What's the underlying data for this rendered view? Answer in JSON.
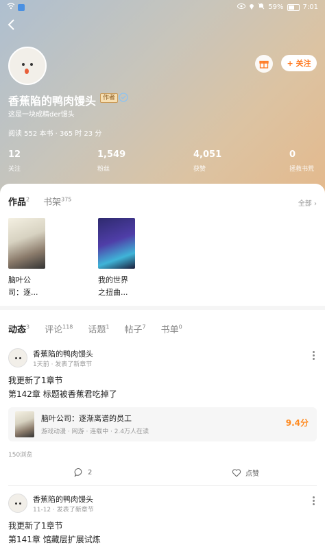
{
  "status_bar": {
    "battery": "59%",
    "time": "7:01"
  },
  "profile": {
    "username": "香蕉陷的鸭肉馒头",
    "badge": "作者",
    "bio": "这是一块成精der馒头",
    "read_stats": "阅读 552 本书 · 365 时 23 分",
    "follow_label": "+ 关注"
  },
  "stats": [
    {
      "value": "12",
      "label": "关注"
    },
    {
      "value": "1,549",
      "label": "粉丝"
    },
    {
      "value": "4,051",
      "label": "获赞"
    },
    {
      "value": "0",
      "label": "拯救书荒"
    }
  ],
  "works_tabs": [
    {
      "label": "作品",
      "count": "2"
    },
    {
      "label": "书架",
      "count": "375"
    }
  ],
  "see_all": "全部",
  "books": [
    {
      "title": "脑叶公司：逐..."
    },
    {
      "title": "我的世界之扭曲..."
    }
  ],
  "feed_tabs": [
    {
      "label": "动态",
      "count": "3"
    },
    {
      "label": "评论",
      "count": "118"
    },
    {
      "label": "话题",
      "count": "1"
    },
    {
      "label": "帖子",
      "count": "7"
    },
    {
      "label": "书单",
      "count": "0"
    }
  ],
  "posts": [
    {
      "author": "香蕉陷的鸭肉馒头",
      "meta": "1天前 · 发表了新章节",
      "line1": "我更新了1章节",
      "line2": "第142章 标题被香蕉君吃掉了",
      "book_title": "脑叶公司：逐渐离谱的员工",
      "book_meta": "游戏动漫 · 网游 · 连载中 · 2.4万人在读",
      "book_score": "9.4分",
      "views": "150浏览",
      "comments": "2",
      "like_label": "点赞"
    },
    {
      "author": "香蕉陷的鸭肉馒头",
      "meta": "11-12 · 发表了新章节",
      "line1": "我更新了1章节",
      "line2": "第141章 馆藏层扩展试炼"
    }
  ]
}
